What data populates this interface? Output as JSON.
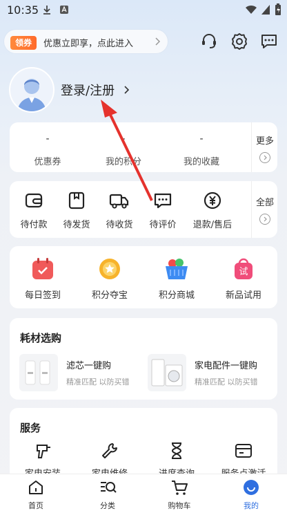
{
  "status_bar": {
    "time": "10:35"
  },
  "promo": {
    "tag": "领券",
    "text": "优惠立即享，点此进入"
  },
  "profile": {
    "login_label": "登录/注册"
  },
  "stats": [
    {
      "value": "-",
      "label": "优惠券"
    },
    {
      "value": "-",
      "label": "我的积分"
    },
    {
      "value": "-",
      "label": "我的收藏"
    }
  ],
  "stats_more": "更多",
  "orders": [
    {
      "label": "待付款",
      "icon": "wallet-icon"
    },
    {
      "label": "待发货",
      "icon": "package-icon"
    },
    {
      "label": "待收货",
      "icon": "truck-icon"
    },
    {
      "label": "待评价",
      "icon": "comment-icon"
    },
    {
      "label": "退款/售后",
      "icon": "refund-icon"
    }
  ],
  "orders_more": "全部",
  "features": [
    {
      "label": "每日签到",
      "icon": "calendar-icon",
      "color": "#f05a5a"
    },
    {
      "label": "积分夺宝",
      "icon": "medal-icon",
      "color": "#f7b32b"
    },
    {
      "label": "积分商城",
      "icon": "basket-icon",
      "color": "#3d8bf2"
    },
    {
      "label": "新品试用",
      "icon": "trial-bag-icon",
      "color": "#f04d7a"
    }
  ],
  "consumables": {
    "title": "耗材选购",
    "items": [
      {
        "title": "滤芯一键购",
        "subtitle": "精准匹配 以防买错"
      },
      {
        "title": "家电配件一键购",
        "subtitle": "精准匹配 以防买错"
      }
    ]
  },
  "services": {
    "title": "服务",
    "items": [
      {
        "label": "家电安装"
      },
      {
        "label": "家电维修"
      },
      {
        "label": "进度查询"
      },
      {
        "label": "服务点激活"
      }
    ]
  },
  "tabbar": [
    {
      "label": "首页",
      "icon": "home-icon"
    },
    {
      "label": "分类",
      "icon": "category-search-icon"
    },
    {
      "label": "购物车",
      "icon": "cart-icon"
    },
    {
      "label": "我的",
      "icon": "me-icon"
    }
  ],
  "colors": {
    "accent": "#2f6fe0",
    "arrow": "#e5322d",
    "promo_tag": "#ff7a33"
  }
}
